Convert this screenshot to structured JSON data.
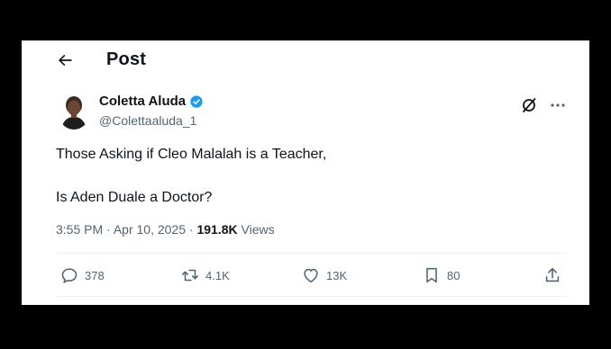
{
  "header": {
    "title": "Post",
    "back_icon": "arrow-left-icon"
  },
  "author": {
    "name": "Coletta Aluda",
    "handle": "@Colettaaluda_1",
    "verified_color": "#1d9bf0"
  },
  "post": {
    "lines": [
      "Those Asking if Cleo Malalah is a Teacher,",
      "Is Aden Duale a Doctor?"
    ],
    "time": "3:55 PM",
    "date": "Apr 10, 2025",
    "separator": "·",
    "views_count": "191.8K",
    "views_label": "Views"
  },
  "actions": {
    "replies": "378",
    "reposts": "4.1K",
    "likes": "13K",
    "bookmarks": "80"
  },
  "colors": {
    "text": "#0f1419",
    "muted": "#536471",
    "accent": "#1d9bf0"
  }
}
